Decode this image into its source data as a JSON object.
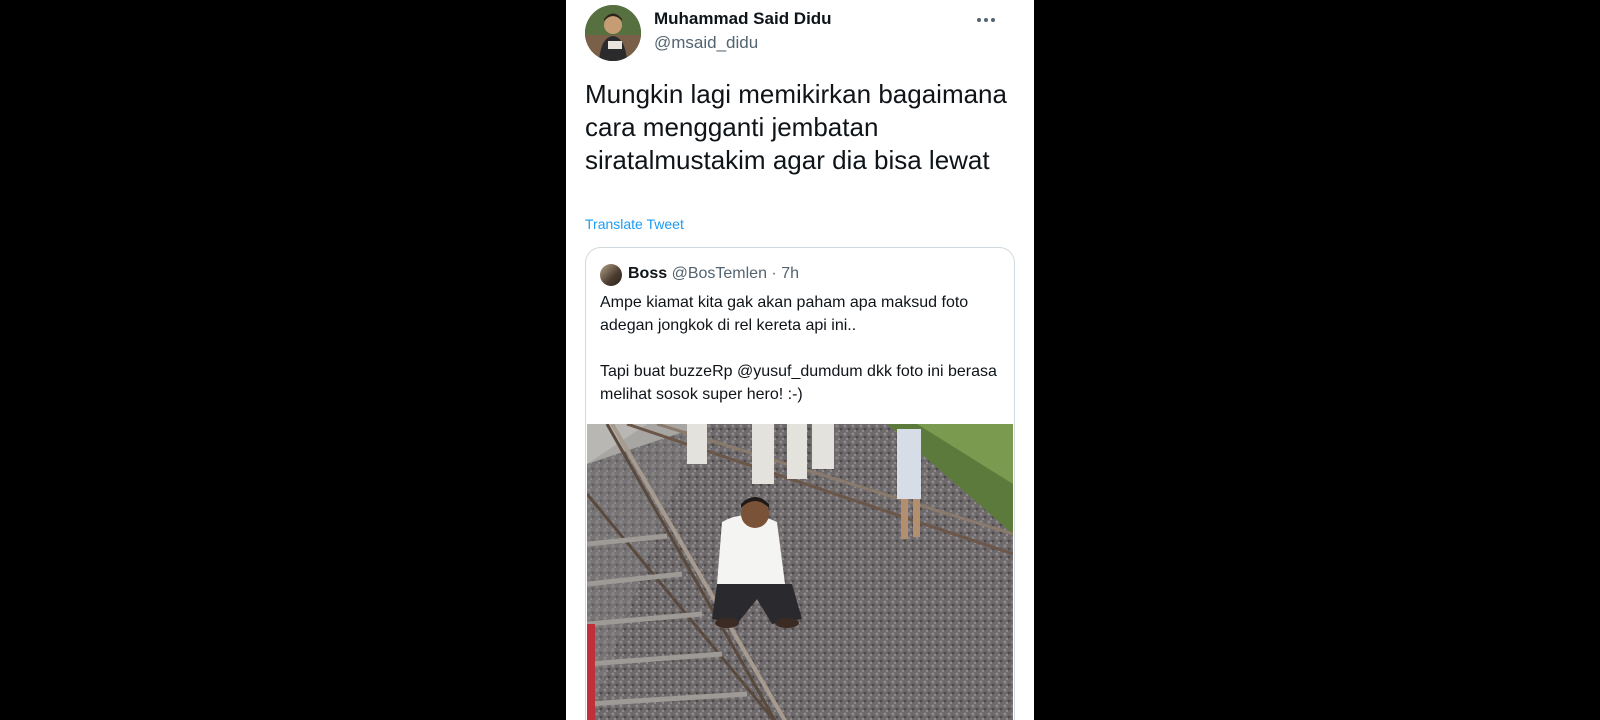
{
  "tweet": {
    "author_name": "Muhammad Said Didu",
    "author_handle": "@msaid_didu",
    "text": "Mungkin lagi memikirkan bagaimana cara mengganti jembatan siratalmustakim agar dia bisa lewat",
    "translate_label": "Translate Tweet",
    "more_icon": "more-horizontal-icon"
  },
  "quote": {
    "author_name": "Boss",
    "author_handle": "@BosTemlen",
    "separator": "·",
    "time": "7h",
    "text_line1": "Ampe kiamat kita gak akan paham apa maksud foto adegan jongkok di rel kereta api ini..",
    "text_line2": "Tapi buat buzzeRp @yusuf_dumdum dkk foto ini berasa melihat sosok super hero! :-)"
  },
  "colors": {
    "background": "#000000",
    "card": "#ffffff",
    "text_primary": "#0f1419",
    "text_secondary": "#536471",
    "link": "#1d9bf0",
    "border": "#cfd9de"
  }
}
